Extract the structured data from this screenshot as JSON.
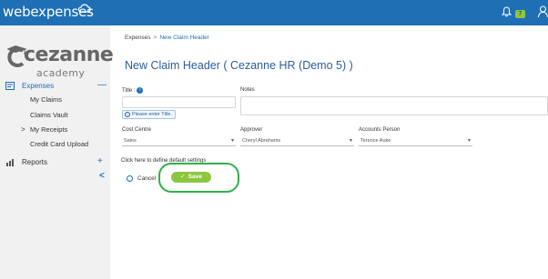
{
  "header": {
    "brand": "webexpenses",
    "notification_count": "7",
    "icons": [
      "cloud-icon",
      "bell-icon",
      "user-icon"
    ],
    "colors": {
      "bar": "#1f6fb5",
      "badge": "#8dc63f"
    }
  },
  "sidebar": {
    "logo_name": "cezanne",
    "logo_sub": "academy",
    "expenses": {
      "label": "Expenses",
      "toggle": "—",
      "icon": "expenses-icon"
    },
    "items": [
      {
        "label": "My Claims"
      },
      {
        "label": "Claims Vault"
      },
      {
        "label": "My Receipts",
        "chevron": ">"
      },
      {
        "label": "Credit Card Upload"
      }
    ],
    "reports": {
      "label": "Reports",
      "toggle": "+",
      "icon": "reports-icon"
    },
    "collapse": "<"
  },
  "main": {
    "breadcrumb": {
      "root": "Expenses",
      "separator": ">",
      "current": "New Claim Header"
    },
    "title": "New Claim Header ( Cezanne HR (Demo 5) )",
    "form": {
      "title_label": "Title :",
      "title_value": "",
      "title_hint": "Please enter Title.",
      "notes_label": "Notes",
      "notes_value": "",
      "cost_centre_label": "Cost Centre",
      "cost_centre_value": "Sales",
      "approver_label": "Approver",
      "approver_value": "Cheryl Abrahams",
      "accounts_person_label": "Accounts Person",
      "accounts_person_value": "Terence Auke",
      "defaults_link": "Click here to define default settings",
      "cancel_label": "Cancel",
      "save_label": "Save",
      "save_icon": "check-icon"
    }
  }
}
